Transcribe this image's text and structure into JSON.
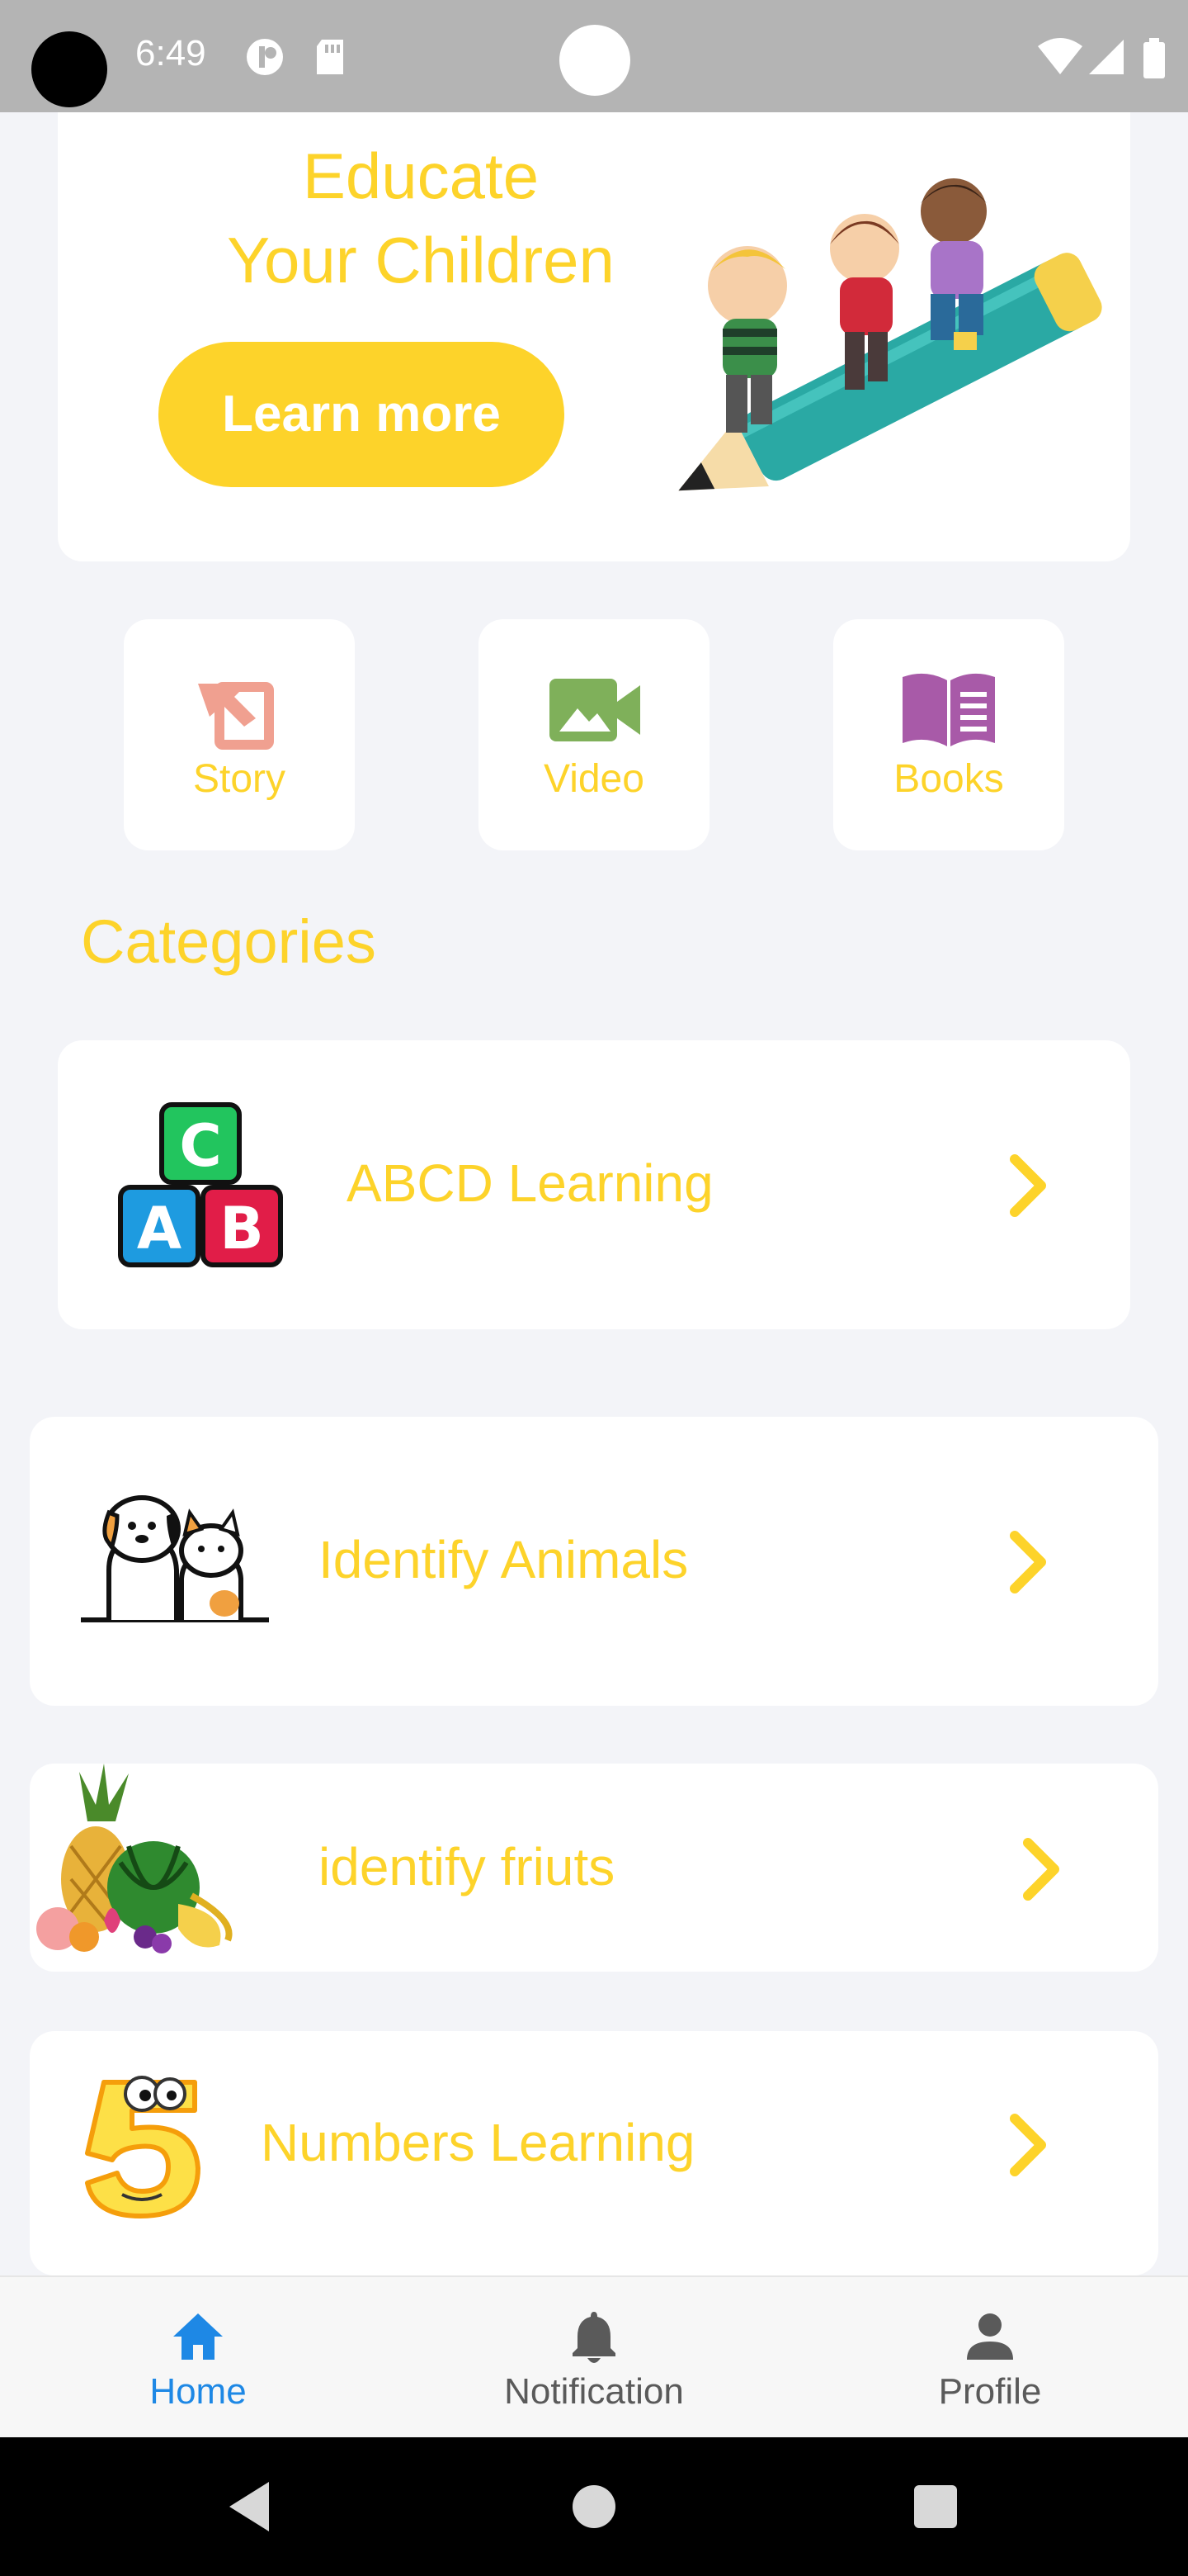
{
  "status_bar": {
    "time": "6:49"
  },
  "hero": {
    "title_line1": "Educate",
    "title_line2": "Your Children",
    "button_label": "Learn more"
  },
  "tiles": [
    {
      "label": "Story",
      "icon": "story-icon",
      "color": "#f0a090"
    },
    {
      "label": "Video",
      "icon": "video-camera-icon",
      "color": "#7fb05a"
    },
    {
      "label": "Books",
      "icon": "open-book-icon",
      "color": "#a85aa8"
    }
  ],
  "categories_title": "Categories",
  "categories": [
    {
      "label": "ABCD Learning",
      "icon": "abc-blocks-icon"
    },
    {
      "label": "Identify Animals",
      "icon": "dog-cat-icon"
    },
    {
      "label": "identify friuts",
      "icon": "fruits-icon"
    },
    {
      "label": "Numbers Learning",
      "icon": "number-five-icon"
    }
  ],
  "bottom_nav": [
    {
      "label": "Home",
      "icon": "home-icon",
      "active": true
    },
    {
      "label": "Notification",
      "icon": "bell-icon",
      "active": false
    },
    {
      "label": "Profile",
      "icon": "person-icon",
      "active": false
    }
  ],
  "colors": {
    "accent": "#fdd32a",
    "active_nav": "#1e88e5",
    "background": "#f3f4f8"
  }
}
